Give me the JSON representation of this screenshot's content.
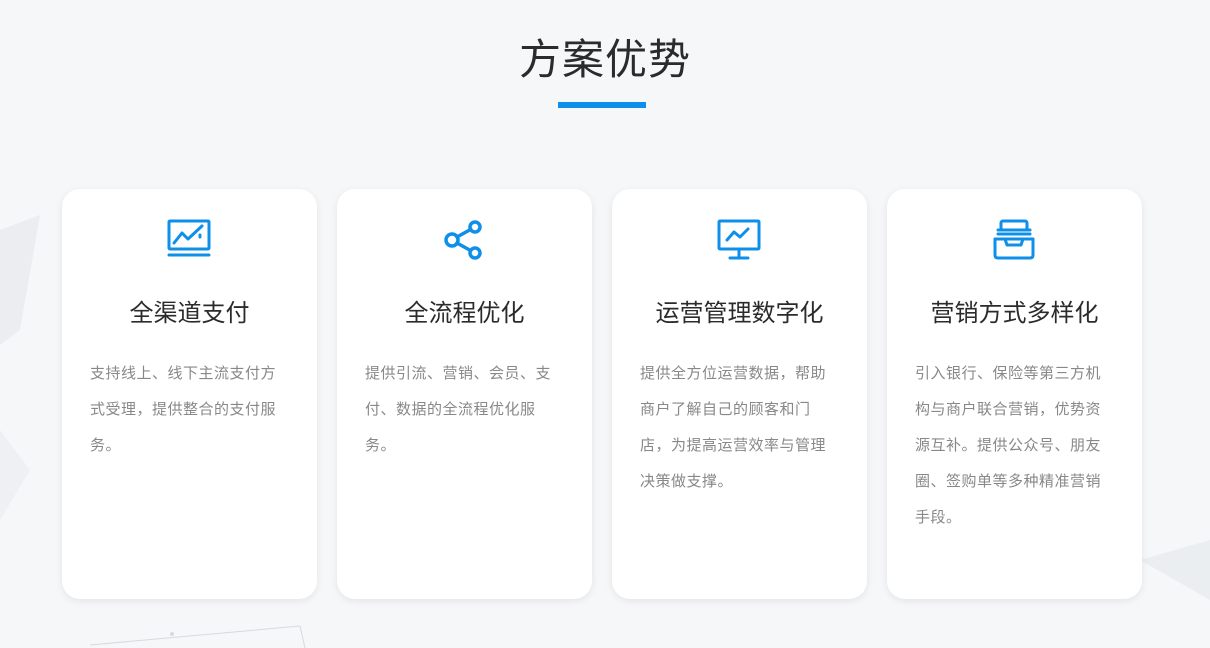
{
  "section": {
    "title": "方案优势"
  },
  "colors": {
    "accent": "#0d8fea",
    "title_text": "#2b2b2b",
    "desc_text": "#888888",
    "background": "#f6f7f9",
    "card_bg": "#ffffff"
  },
  "cards": [
    {
      "icon": "line-chart-icon",
      "title": "全渠道支付",
      "desc": "支持线上、线下主流支付方式受理，提供整合的支付服务。"
    },
    {
      "icon": "share-icon",
      "title": "全流程优化",
      "desc": "提供引流、营销、会员、支付、数据的全流程优化服务。"
    },
    {
      "icon": "monitor-chart-icon",
      "title": "运营管理数字化",
      "desc": "提供全方位运营数据，帮助商户了解自己的顾客和门店，为提高运营效率与管理决策做支撑。"
    },
    {
      "icon": "inbox-tray-icon",
      "title": "营销方式多样化",
      "desc": "引入银行、保险等第三方机构与商户联合营销，优势资源互补。提供公众号、朋友圈、签购单等多种精准营销手段。"
    }
  ]
}
